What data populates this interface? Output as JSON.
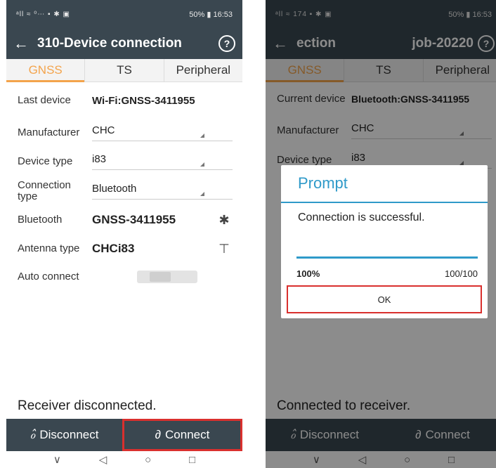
{
  "left": {
    "status": {
      "signal": "ᵃll ≈ ⁰⋯ ▪ ✱ ▣",
      "battery": "50%",
      "time": "16:53"
    },
    "title": "310-Device connection",
    "tabs": [
      "GNSS",
      "TS",
      "Peripheral"
    ],
    "rows": [
      {
        "label": "Last device",
        "value": "Wi-Fi:GNSS-3411955"
      },
      {
        "label": "Manufacturer",
        "value": "CHC"
      },
      {
        "label": "Device type",
        "value": "i83"
      },
      {
        "label": "Connection type",
        "value": "Bluetooth"
      },
      {
        "label": "Bluetooth",
        "value": "GNSS-3411955"
      },
      {
        "label": "Antenna type",
        "value": "CHCi83"
      },
      {
        "label": "Auto connect",
        "value": ""
      }
    ],
    "status_text": "Receiver disconnected.",
    "disconnect_label": "Disconnect",
    "connect_label": "Connect"
  },
  "right": {
    "status": {
      "signal": "ᵃll ≈ 174 ▪ ✱ ▣",
      "battery": "50%",
      "time": "16:53"
    },
    "title_left": "ection",
    "title_right": "job-20220",
    "tabs": [
      "GNSS",
      "TS",
      "Peripheral"
    ],
    "rows": [
      {
        "label": "Current device",
        "value": "Bluetooth:GNSS-3411955"
      },
      {
        "label": "Manufacturer",
        "value": "CHC"
      },
      {
        "label": "Device type",
        "value": "i83"
      }
    ],
    "status_text": "Connected to receiver.",
    "disconnect_label": "Disconnect",
    "connect_label": "Connect",
    "dialog": {
      "title": "Prompt",
      "message": "Connection is successful.",
      "percent": "100%",
      "count": "100/100",
      "progress": 1.0,
      "ok_label": "OK"
    }
  },
  "icons": {
    "back": "arrow-left-icon",
    "help": "question-circle-icon",
    "bluetooth": "bluetooth-icon",
    "antenna": "antenna-icon",
    "link": "link-icon",
    "unlink": "unlink-icon"
  },
  "colors": {
    "appbar": "#3a4750",
    "tab_active": "#f3a44c",
    "dialog_accent": "#2f9ac9",
    "highlight": "#d9302e"
  }
}
